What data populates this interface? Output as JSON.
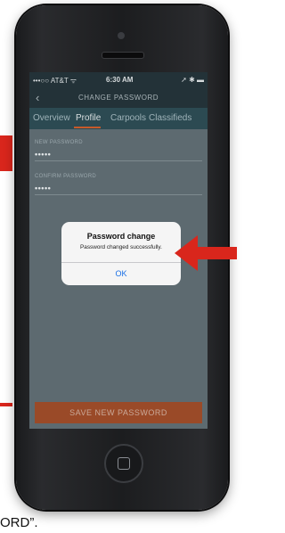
{
  "status_bar": {
    "carrier": "•••○○ AT&T ᯤ",
    "time": "6:30 AM",
    "right_icons": "➚ ✱ ▬"
  },
  "nav": {
    "back": "‹",
    "title": "CHANGE PASSWORD"
  },
  "tabs": [
    "Overview",
    "Profile",
    "Carpools",
    "Classifieds"
  ],
  "active_tab": "Profile",
  "form": {
    "new_password_label": "NEW PASSWORD",
    "new_password_value": "•••••",
    "confirm_password_label": "CONFIRM PASSWORD",
    "confirm_password_value": "•••••"
  },
  "save_button": "SAVE NEW PASSWORD",
  "dialog": {
    "title": "Password change",
    "message": "Password changed successfully.",
    "ok": "OK"
  },
  "caption": "ORD”.",
  "colors": {
    "accent": "#c85a2a",
    "annotation_red": "#d9261c",
    "nav_bg": "#233238",
    "ok_blue": "#1a6fe6"
  }
}
